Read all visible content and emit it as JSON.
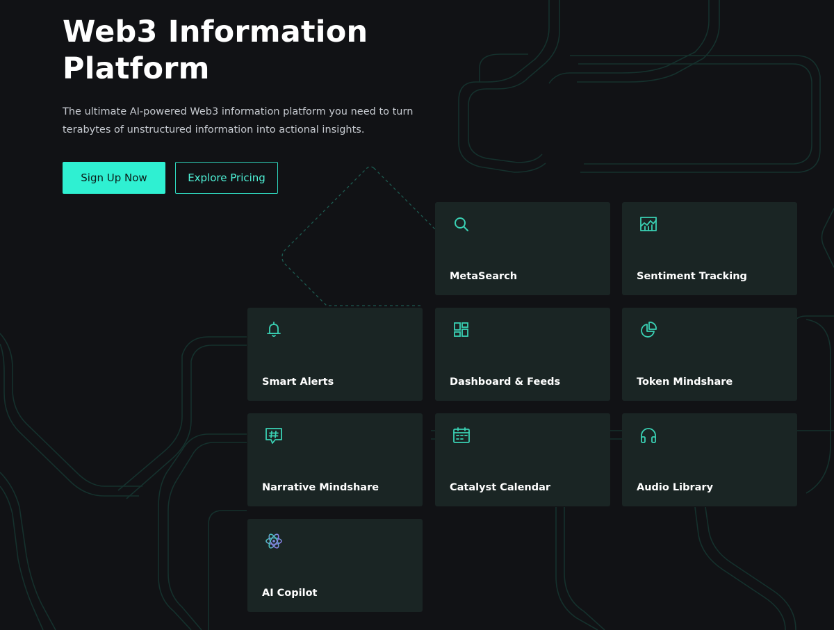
{
  "hero": {
    "title_line1": "Web3 Information",
    "title_line2": "Platform",
    "subtitle_line1": "The ultimate AI-powered Web3 information platform you need to turn",
    "subtitle_line2": "terabytes of unstructured information into actional insights."
  },
  "cta": {
    "primary_label": "Sign Up Now",
    "secondary_label": "Explore Pricing"
  },
  "features": [
    {
      "label": "MetaSearch",
      "icon": "search-icon"
    },
    {
      "label": "Sentiment Tracking",
      "icon": "area-chart-icon"
    },
    {
      "label": "Smart Alerts",
      "icon": "bell-icon"
    },
    {
      "label": "Dashboard & Feeds",
      "icon": "dashboard-grid-icon"
    },
    {
      "label": "Token Mindshare",
      "icon": "pie-chart-icon"
    },
    {
      "label": "Narrative Mindshare",
      "icon": "hashtag-message-icon"
    },
    {
      "label": "Catalyst Calendar",
      "icon": "calendar-icon"
    },
    {
      "label": "Audio Library",
      "icon": "headphones-icon"
    },
    {
      "label": "AI Copilot",
      "icon": "atom-icon"
    }
  ],
  "colors": {
    "background": "#111215",
    "accent": "#2ff0d2",
    "card": "#1a2524",
    "icon": "#3ad1b4"
  }
}
